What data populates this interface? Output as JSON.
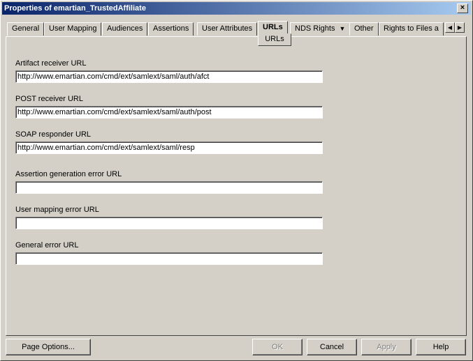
{
  "window": {
    "title": "Properties of emartian_TrustedAffiliate",
    "close_label": "×"
  },
  "tabs": [
    {
      "label": "General"
    },
    {
      "label": "User Mapping"
    },
    {
      "label": "Audiences"
    },
    {
      "label": "Assertions"
    },
    {
      "label": "User Attributes"
    },
    {
      "label": "URLs"
    },
    {
      "label": "NDS Rights"
    },
    {
      "label": "Other"
    },
    {
      "label": "Rights to Files a"
    }
  ],
  "active_tab": "URLs",
  "subtab": {
    "label": "URLs"
  },
  "tab_scroll": {
    "left": "◀",
    "right": "▶"
  },
  "fields": {
    "artifact": {
      "label": "Artifact receiver URL",
      "value": "http://www.emartian.com/cmd/ext/samlext/saml/auth/afct"
    },
    "post": {
      "label": "POST receiver URL",
      "value": "http://www.emartian.com/cmd/ext/samlext/saml/auth/post"
    },
    "soap": {
      "label": "SOAP responder URL",
      "value": "http://www.emartian.com/cmd/ext/samlext/saml/resp"
    },
    "assertion_error": {
      "label": "Assertion generation error URL",
      "value": ""
    },
    "user_mapping_error": {
      "label": "User mapping error URL",
      "value": ""
    },
    "general_error": {
      "label": "General error URL",
      "value": ""
    }
  },
  "buttons": {
    "page_options": "Page Options...",
    "ok": "OK",
    "cancel": "Cancel",
    "apply": "Apply",
    "help": "Help"
  }
}
